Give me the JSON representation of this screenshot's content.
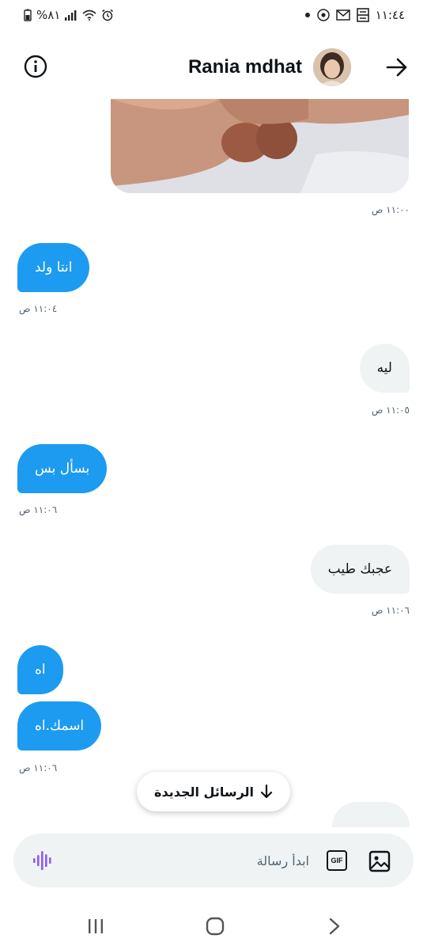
{
  "status_bar": {
    "time": "١١:٤٤",
    "battery": "%٨١"
  },
  "header": {
    "contact_name": "Rania mdhat"
  },
  "messages": [
    {
      "direction": "out",
      "kind": "image",
      "time": "١١:٠٠ ص"
    },
    {
      "direction": "in",
      "text": "انتا ولد",
      "time": "١١:٠٤ ص"
    },
    {
      "direction": "out",
      "text": "ليه",
      "time": "١١:٠٥ ص"
    },
    {
      "direction": "in",
      "text": "بسأل بس",
      "time": "١١:٠٦ ص"
    },
    {
      "direction": "out",
      "text": "عجبك طيب",
      "time": "١١:٠٦ ص"
    },
    {
      "direction": "in",
      "text": "اه",
      "time": ""
    },
    {
      "direction": "in",
      "text": "اسمك.اه",
      "time": "١١:٠٦ ص"
    }
  ],
  "new_messages_pill": {
    "label": "الرسائل الجديدة",
    "icon": "arrow-down-icon"
  },
  "composer": {
    "placeholder": "ابدأ رسالة",
    "gif_label": "GIF"
  },
  "colors": {
    "incoming_bubble": "#1d9bf0",
    "outgoing_bubble": "#eff3f4",
    "voice_icon": "#8b5cf6"
  }
}
